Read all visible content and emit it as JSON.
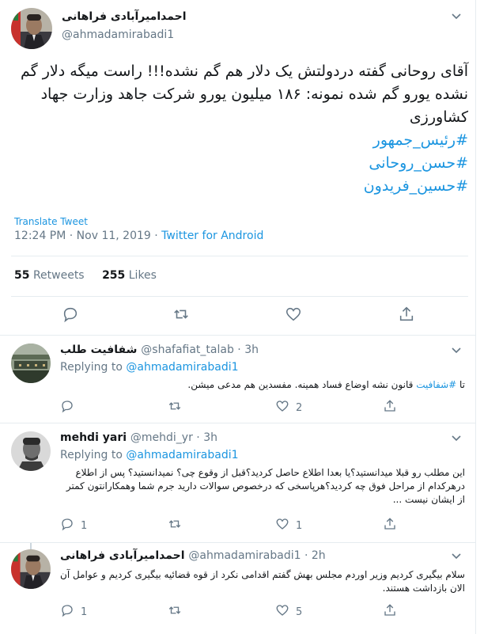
{
  "main_tweet": {
    "name": "احمدامیرآبادی فراهانی",
    "handle": "@ahmadamirabadi1",
    "text": "آقای روحانی گفته دردولتش یک دلار هم گم نشده!!! راست میگه دلار گم نشده یورو گم شده نمونه: ۱۸۶ میلیون یورو شرکت جاهد وزارت جهاد کشاورزی",
    "hashtags": [
      "#رئیس_جمهور",
      "#حسن_روحانی",
      "#حسین_فریدون"
    ],
    "translate_label": "Translate Tweet",
    "timestamp": "12:24 PM · Nov 11, 2019 · ",
    "source": "Twitter for Android",
    "retweets_count": "55",
    "retweets_label": "Retweets",
    "likes_count": "255",
    "likes_label": "Likes"
  },
  "replies": [
    {
      "name": "شفافیت طلب",
      "handle": "@shafafiat_talab · 3h",
      "replying_prefix": "Replying to ",
      "replying_to": "@ahmadamirabadi1",
      "text_prefix": "تا ",
      "text_tag": "#شفافیت",
      "text_rest": " قانون نشه اوضاع فساد همینه. مفسدین هم مدعی میشن.",
      "reply_count": "",
      "retweet_count": "",
      "like_count": "2"
    },
    {
      "name": "mehdi yari",
      "handle": "@mehdi_yr · 3h",
      "replying_prefix": "Replying to ",
      "replying_to": "@ahmadamirabadi1",
      "text": "این مطلب رو قبلا میدانستید؟یا بعدا اطلاع حاصل کردید؟قبل از وقوع چی؟ نمیدانستید؟ پس از اطلاع درهرکدام از مراحل فوق چه کردید؟هرپاسخی که درخصوص سوالات دارید جرم شما وهمکارانتون کمتر از ایشان نیست ...",
      "reply_count": "1",
      "retweet_count": "",
      "like_count": "1"
    },
    {
      "name": "احمدامیرآبادی فراهانی",
      "handle": "@ahmadamirabadi1 · 2h",
      "text": "سلام بیگیری کردیم وزیر اوردم مجلس بهش گفتم اقدامی نکرد از قوه قضائیه بیگیری کردیم و عوامل آن الان بازداشت هستند.",
      "reply_count": "1",
      "retweet_count": "",
      "like_count": "5"
    }
  ],
  "icons": {
    "reply": "reply-icon",
    "retweet": "retweet-icon",
    "like": "heart-icon",
    "share": "share-icon",
    "more": "chevron-down-icon"
  },
  "colors": {
    "link": "#1b95e0",
    "muted": "#657786",
    "text": "#14171a",
    "border": "#e6ecf0"
  }
}
